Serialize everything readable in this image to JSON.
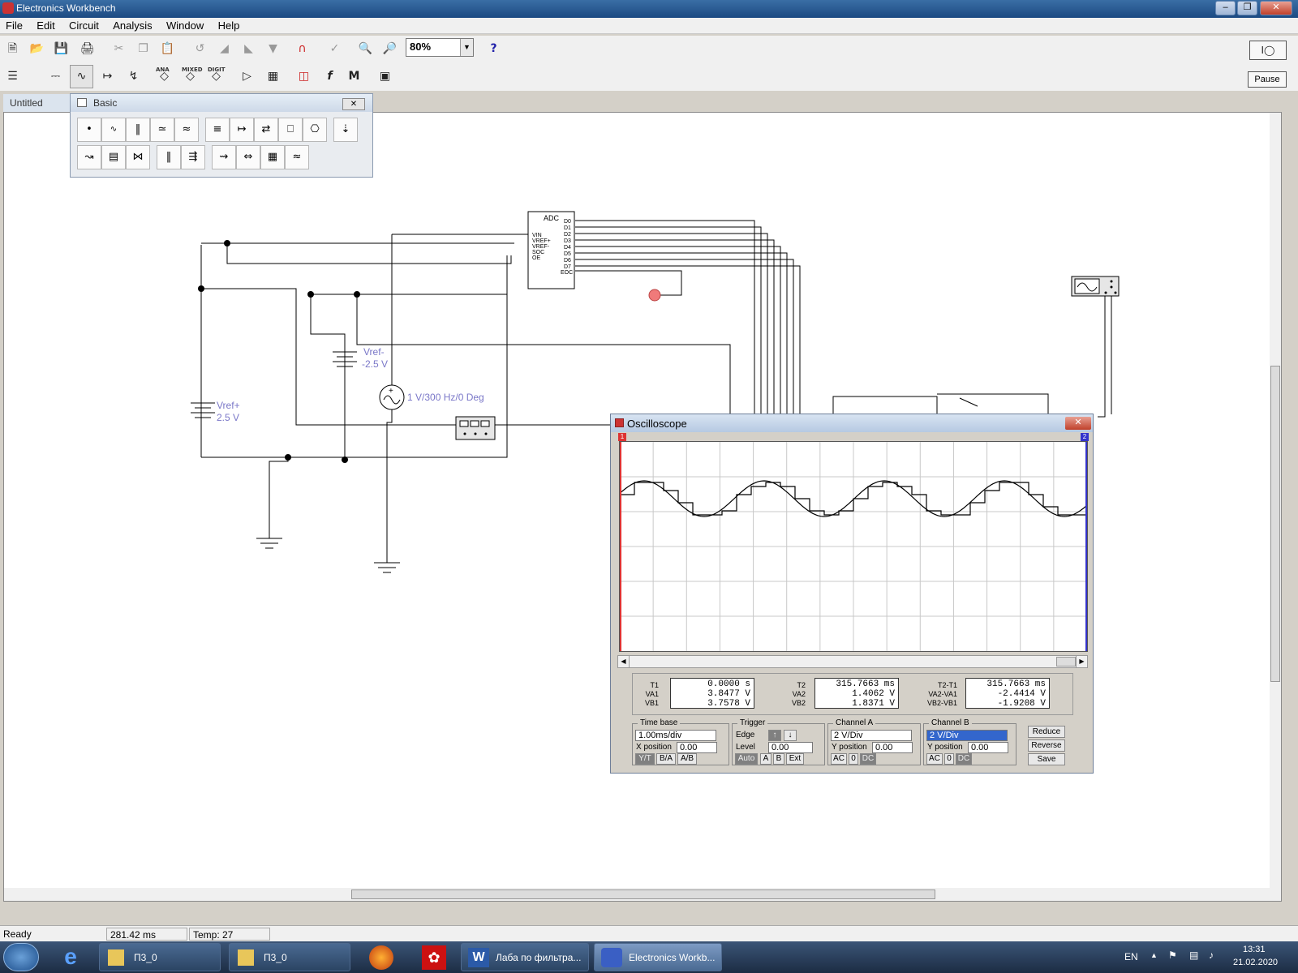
{
  "app": {
    "title": "Electronics Workbench"
  },
  "menu": [
    "File",
    "Edit",
    "Circuit",
    "Analysis",
    "Window",
    "Help"
  ],
  "toolbar": {
    "zoom": "80%",
    "help": "?",
    "pause_label": "Pause",
    "icon_labels": [
      "ANA",
      "MIXED",
      "DIGIT"
    ],
    "m_label": "M",
    "f_label": "f"
  },
  "document": {
    "tab": "Untitled"
  },
  "palette": {
    "title": "Basic"
  },
  "circuit": {
    "adc": {
      "title": "ADC",
      "pins_left": [
        "VIN",
        "VREF+",
        "VREF-",
        "SOC",
        "OE"
      ],
      "pins_right": [
        "D0",
        "D1",
        "D2",
        "D3",
        "D4",
        "D5",
        "D6",
        "D7",
        "EOC"
      ]
    },
    "vref_minus": {
      "name": "Vref-",
      "value": "-2.5 V"
    },
    "vref_plus": {
      "name": "Vref+",
      "value": "2.5 V"
    },
    "ac_source": {
      "label": "1 V/300 Hz/0 Deg"
    }
  },
  "oscilloscope": {
    "title": "Oscilloscope",
    "readout": {
      "t1": {
        "T1": "0.0000 s",
        "VA1": "3.8477 V",
        "VB1": "3.7578 V"
      },
      "t2": {
        "T2": "315.7663 ms",
        "VA2": "1.4062 V",
        "VB2": "1.8371 V"
      },
      "diff": {
        "T2-T1": "315.7663 ms",
        "VA2-VA1": "-2.4414 V",
        "VB2-VB1": "-1.9208 V"
      }
    },
    "time_base": {
      "label": "Time base",
      "value": "1.00ms/div",
      "x_position_label": "X position",
      "x_position": "0.00",
      "modes": [
        "Y/T",
        "B/A",
        "A/B"
      ]
    },
    "trigger": {
      "label": "Trigger",
      "edge_label": "Edge",
      "level_label": "Level",
      "level": "0.00",
      "buttons": [
        "Auto",
        "A",
        "B",
        "Ext"
      ]
    },
    "channel_a": {
      "label": "Channel A",
      "scale": "2 V/Div",
      "y_position_label": "Y position",
      "y_position": "0.00",
      "coupling": [
        "AC",
        "0",
        "DC"
      ]
    },
    "channel_b": {
      "label": "Channel B",
      "scale": "2 V/Div",
      "y_position_label": "Y position",
      "y_position": "0.00",
      "coupling": [
        "AC",
        "0",
        "DC"
      ]
    },
    "side_buttons": [
      "Reduce",
      "Reverse",
      "Save"
    ],
    "cursor_markers": [
      "1",
      "2"
    ]
  },
  "status": {
    "text": "Ready",
    "time": "281.42 ms",
    "temp": "Temp: 27"
  },
  "taskbar": {
    "items": [
      "П3_0",
      "П3_0",
      "Лаба по фильтра...",
      "Electronics Workb..."
    ],
    "lang": "EN",
    "time": "13:31",
    "date": "21.02.2020"
  }
}
